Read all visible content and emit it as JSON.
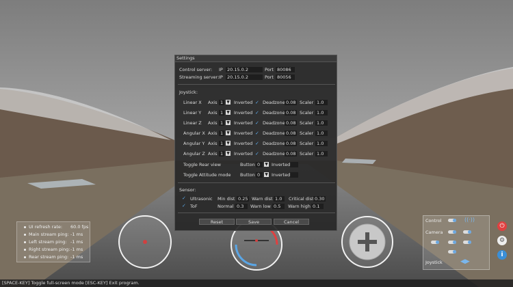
{
  "dialog": {
    "title": "Settings",
    "control_server": {
      "label": "Control server:",
      "ip_label": "IP",
      "ip": "20.15.0.2",
      "port_label": "Port",
      "port": "80086"
    },
    "streaming_server": {
      "label": "Streaming server:",
      "ip_label": "IP",
      "ip": "20.15.0.2",
      "port_label": "Port",
      "port": "80056"
    },
    "joystick_label": "Joystick:",
    "axes": [
      {
        "name": "Linear X",
        "axis_label": "Axis",
        "axis": "1",
        "inverted": "Inverted",
        "deadzone_label": "Deadzone",
        "deadzone": "0.08",
        "scaler_label": "Scaler",
        "scaler": "1.0"
      },
      {
        "name": "Linear Y",
        "axis_label": "Axis",
        "axis": "1",
        "inverted": "Inverted",
        "deadzone_label": "Deadzone",
        "deadzone": "0.08",
        "scaler_label": "Scaler",
        "scaler": "1.0"
      },
      {
        "name": "Linear Z",
        "axis_label": "Axis",
        "axis": "1",
        "inverted": "Inverted",
        "deadzone_label": "Deadzone",
        "deadzone": "0.08",
        "scaler_label": "Scaler",
        "scaler": "1.0"
      },
      {
        "name": "Angular X",
        "axis_label": "Axis",
        "axis": "1",
        "inverted": "Inverted",
        "deadzone_label": "Deadzone",
        "deadzone": "0.08",
        "scaler_label": "Scaler",
        "scaler": "1.0"
      },
      {
        "name": "Angular Y",
        "axis_label": "Axis",
        "axis": "1",
        "inverted": "Inverted",
        "deadzone_label": "Deadzone",
        "deadzone": "0.08",
        "scaler_label": "Scaler",
        "scaler": "1.0"
      },
      {
        "name": "Angular Z",
        "axis_label": "Axis",
        "axis": "1",
        "inverted": "Inverted",
        "deadzone_label": "Deadzone",
        "deadzone": "0.08",
        "scaler_label": "Scaler",
        "scaler": "1.0"
      }
    ],
    "toggles": [
      {
        "name": "Toggle Rear view",
        "button_label": "Button",
        "button": "0",
        "inverted": "Inverted"
      },
      {
        "name": "Toggle Attitude mode",
        "button_label": "Button",
        "button": "0",
        "inverted": "Inverted"
      }
    ],
    "sensor_label": "Sensor:",
    "ultrasonic": {
      "name": "Ultrasonic",
      "min_label": "Min dist",
      "min": "0.25",
      "warn_label": "Warn dist",
      "warn": "1.0",
      "crit_label": "Critical dist",
      "crit": "0.30"
    },
    "tof": {
      "name": "ToF",
      "normal_label": "Normal",
      "normal": "0.3",
      "low_label": "Warn low",
      "low": "0.5",
      "high_label": "Warn high",
      "high": "0.1"
    },
    "buttons": {
      "reset": "Reset",
      "save": "Save",
      "cancel": "Cancel"
    }
  },
  "stats": [
    {
      "label": "UI refresh rate:",
      "value": "60.0 fps"
    },
    {
      "label": "Main stream ping:",
      "value": "-1 ms"
    },
    {
      "label": "Left stream ping:",
      "value": "-1 ms"
    },
    {
      "label": "Right stream ping:",
      "value": "-1 ms"
    },
    {
      "label": "Rear stream ping:",
      "value": "-1 ms"
    }
  ],
  "control_panel": {
    "control": "Control",
    "camera": "Camera",
    "joystick": "Joystick"
  },
  "footer": "[SPACE-KEY] Toggle full-screen mode [ESC-KEY] Exit program.",
  "colors": {
    "accent": "#5aa6e6",
    "power": "#e04040",
    "info": "#3a8fd8"
  }
}
